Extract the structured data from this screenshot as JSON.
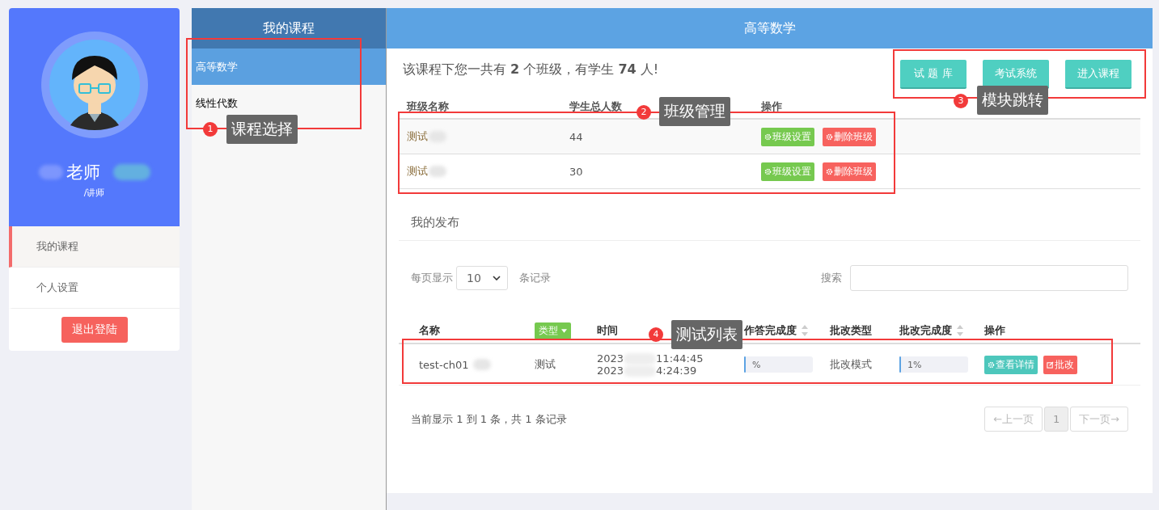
{
  "profile": {
    "name": "老师",
    "role": "/讲师"
  },
  "nav": [
    {
      "label": "我的课程",
      "selected": true
    },
    {
      "label": "个人设置",
      "selected": false
    }
  ],
  "logout": "退出登陆",
  "courses": {
    "title": "我的课程",
    "items": [
      {
        "label": "高等数学",
        "selected": true
      },
      {
        "label": "线性代数",
        "selected": false
      }
    ]
  },
  "main": {
    "title": "高等数学",
    "summary": "该课程下您一共有 **2** 个班级，有学生 **74** 人!",
    "actions": [
      "试 题 库",
      "考试系统",
      "进入课程"
    ],
    "class_table": {
      "columns": [
        "班级名称",
        "学生总人数",
        "操作"
      ],
      "rows": [
        {
          "name": "测试",
          "count": "44",
          "buttons": [
            {
              "label": "班级设置",
              "kind": "settings"
            },
            {
              "label": "删除班级",
              "kind": "delete"
            }
          ]
        },
        {
          "name": "测试",
          "count": "30",
          "buttons": [
            {
              "label": "班级设置",
              "kind": "settings"
            },
            {
              "label": "删除班级",
              "kind": "delete"
            }
          ]
        }
      ]
    },
    "publish": {
      "title": "我的发布",
      "page_size_label": "每页显示",
      "page_size": "10",
      "records_label": "条记录",
      "search_label": "搜索",
      "columns": [
        {
          "label": "名称",
          "kind": "text",
          "sortable": false
        },
        {
          "label": "类型",
          "kind": "dropdown",
          "sortable": false
        },
        {
          "label": "时间",
          "kind": "text",
          "sortable": false
        },
        {
          "label": "作答完成度",
          "kind": "text",
          "sortable": true
        },
        {
          "label": "批改类型",
          "kind": "text",
          "sortable": false
        },
        {
          "label": "批改完成度",
          "kind": "text",
          "sortable": true
        },
        {
          "label": "操作",
          "kind": "text",
          "sortable": false
        }
      ],
      "rows": [
        {
          "name": "test-ch01",
          "type": "测试",
          "times": [
            [
              "2023",
              "11:44:45"
            ],
            [
              "2023",
              "4:24:39"
            ]
          ],
          "answer_progress": {
            "text": "%",
            "level": 0.02
          },
          "grade_type": "批改模式",
          "grade_progress": {
            "text": "1%",
            "level": 0.02
          },
          "buttons": [
            {
              "label": "查看详情",
              "kind": "detail"
            },
            {
              "label": "批改",
              "kind": "grade"
            }
          ]
        }
      ],
      "info": "当前显示 1 到 1 条，共 1 条记录",
      "pages": [
        {
          "label": "←上一页",
          "kind": "nav",
          "disabled": true,
          "selected": false
        },
        {
          "label": "1",
          "kind": "page",
          "disabled": false,
          "selected": true
        },
        {
          "label": "下一页→",
          "kind": "nav",
          "disabled": true,
          "selected": false
        }
      ]
    }
  },
  "annotations": [
    {
      "number": "1",
      "label": "课程选择"
    },
    {
      "number": "2",
      "label": "班级管理"
    },
    {
      "number": "3",
      "label": "模块跳转"
    },
    {
      "number": "4",
      "label": "测试列表"
    }
  ]
}
